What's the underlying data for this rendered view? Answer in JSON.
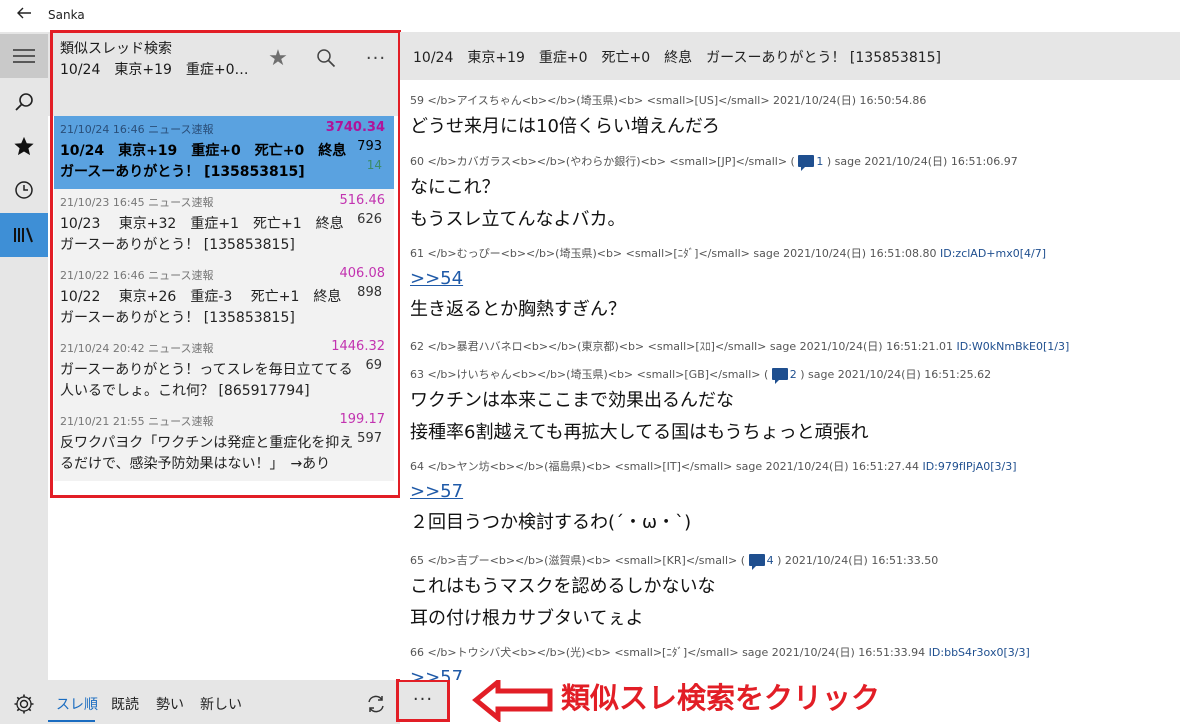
{
  "app": {
    "title": "Sanka"
  },
  "nav": {
    "icons": [
      "hamburger-icon",
      "search-icon",
      "star-icon",
      "history-icon",
      "board-icon",
      "gear-icon"
    ]
  },
  "list_header": {
    "title": "類似スレッド検索",
    "subtitle": "10/24　東京+19　重症+0　死亡+0　終息　ガースーありがとう！ [135853815]",
    "star": "★",
    "more": "···"
  },
  "threads": [
    {
      "meta": "21/10/24 16:46  ニュース速報",
      "speed": "3740.34",
      "title": "10/24　東京+19　重症+0　死亡+0　終息　ガースーありがとう！ [135853815]",
      "count": "793",
      "new": "14"
    },
    {
      "meta": "21/10/23 16:45  ニュース速報",
      "speed": "516.46",
      "title": "10/23　 東京+32　重症+1　死亡+1　終息　ガースーありがとう！ [135853815]",
      "count": "626",
      "new": ""
    },
    {
      "meta": "21/10/22 16:46  ニュース速報",
      "speed": "406.08",
      "title": "10/22　 東京+26　重症-3　 死亡+1　終息　ガースーありがとう！ [135853815]",
      "count": "898",
      "new": ""
    },
    {
      "meta": "21/10/24 20:42  ニュース速報",
      "speed": "1446.32",
      "title": "ガースーありがとう！ってスレを毎日立ててる人いるでしょ。これ何？ [865917794]",
      "count": "69",
      "new": ""
    },
    {
      "meta": "21/10/21 21:55  ニュース速報",
      "speed": "199.17",
      "title": "反ワクパヨク「ワクチンは発症と重症化を抑えるだけで、感染予防効果はない！」　→ありま...",
      "count": "597",
      "new": ""
    }
  ],
  "bottom": {
    "tabs": [
      "スレ順",
      "既読",
      "勢い",
      "新しい"
    ],
    "more": "···",
    "annotation": "類似スレ検索をクリック"
  },
  "read_header": {
    "title": "10/24　東京+19　重症+0　死亡+0　終息　ガースーありがとう！ [135853815]"
  },
  "posts": [
    {
      "head": "59 </b>アイスちゃん<b></b>(埼玉県)<b> <small>[US]</small>  2021/10/24(日) 16:50:54.86",
      "replies": "",
      "head2": "",
      "id": "",
      "link": "",
      "lines": [
        "どうせ来月には10倍くらい増えんだろ"
      ]
    },
    {
      "head": "60 </b>カバガラス<b></b>(やわらか銀行)<b> <small>[JP]</small> (",
      "replies": "1",
      "head2": ") sage 2021/10/24(日) 16:51:06.97",
      "id": "",
      "link": "",
      "lines": [
        "なにこれ？",
        "もうスレ立てんなよバカ。"
      ]
    },
    {
      "head": "61 </b>むっぴー<b></b>(埼玉県)<b> <small>[ﾆﾀﾞ]</small>  sage 2021/10/24(日) 16:51:08.80 ",
      "replies": "",
      "head2": "",
      "id": "ID:zclAD+mx0[4/7]",
      "link": ">>54",
      "lines": [
        "生き返るとか胸熱すぎん？"
      ]
    },
    {
      "head": "62 </b>暴君ハバネロ<b></b>(東京都)<b> <small>[ｽﾛ]</small>  sage 2021/10/24(日) 16:51:21.01 ",
      "replies": "",
      "head2": "",
      "id": "ID:W0kNmBkE0[1/3]",
      "link": "",
      "lines": []
    },
    {
      "head": "63 </b>けいちゃん<b></b>(埼玉県)<b> <small>[GB]</small> (",
      "replies": "2",
      "head2": ") sage 2021/10/24(日) 16:51:25.62",
      "id": "",
      "link": "",
      "lines": [
        "ワクチンは本来ここまで効果出るんだな",
        "接種率6割越えても再拡大してる国はもうちょっと頑張れ"
      ]
    },
    {
      "head": "64 </b>ヤン坊<b></b>(福島県)<b> <small>[IT]</small>  sage 2021/10/24(日) 16:51:27.44 ",
      "replies": "",
      "head2": "",
      "id": "ID:979fIPjA0[3/3]",
      "link": ">>57",
      "lines": [
        "２回目うつか検討するわ(´・ω・`)"
      ]
    },
    {
      "head": "65 </b>吉プー<b></b>(滋賀県)<b> <small>[KR]</small> (",
      "replies": "4",
      "head2": ") 2021/10/24(日) 16:51:33.50",
      "id": "",
      "link": "",
      "lines": [
        "これはもうマスクを認めるしかないな",
        "耳の付け根カサブタいてぇよ"
      ]
    },
    {
      "head": "66 </b>トウシバ犬<b></b>(光)<b> <small>[ﾆﾀﾞ]</small>  sage 2021/10/24(日) 16:51:33.94 ",
      "replies": "",
      "head2": "",
      "id": "ID:bbS4r3ox0[3/3]",
      "link": ">>57",
      "lines": []
    }
  ]
}
